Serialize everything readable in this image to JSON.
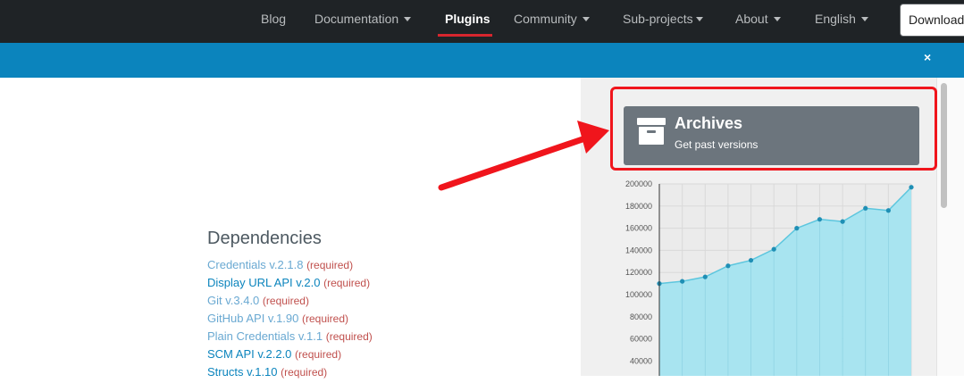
{
  "nav": {
    "items": [
      {
        "label": "Blog",
        "dropdown": false,
        "active": false
      },
      {
        "label": "Documentation",
        "dropdown": true,
        "active": false
      },
      {
        "label": "Plugins",
        "dropdown": false,
        "active": true
      },
      {
        "label": "Community",
        "dropdown": true,
        "active": false
      },
      {
        "label": "Sub-projects",
        "dropdown": true,
        "active": false
      },
      {
        "label": "About",
        "dropdown": true,
        "active": false
      },
      {
        "label": "English",
        "dropdown": true,
        "active": false
      }
    ],
    "download_label": "Download"
  },
  "banner": {
    "close_glyph": "×"
  },
  "archives": {
    "title": "Archives",
    "subtitle": "Get past versions"
  },
  "chart_data": {
    "type": "area",
    "title": "",
    "xlabel": "",
    "ylabel": "",
    "ylim": [
      0,
      200000
    ],
    "yticks": [
      40000,
      60000,
      80000,
      100000,
      120000,
      140000,
      160000,
      180000,
      200000
    ],
    "tick_labels": [
      "40000",
      "60000",
      "80000",
      "100000",
      "120000",
      "140000",
      "160000",
      "180000",
      "200000"
    ],
    "grid": true,
    "legend": "none",
    "values": [
      110000,
      112000,
      116000,
      126000,
      131000,
      141000,
      160000,
      168000,
      166000,
      178000,
      176000,
      197000
    ],
    "color": "#a4e4f0",
    "line_color": "#5cc6de"
  },
  "dependencies": {
    "title": "Dependencies",
    "items": [
      {
        "name": "Credentials v.2.1.8",
        "note": "(required)",
        "visited": true
      },
      {
        "name": "Display URL API v.2.0",
        "note": "(required)",
        "visited": false
      },
      {
        "name": "Git v.3.4.0",
        "note": "(required)",
        "visited": true
      },
      {
        "name": "GitHub API v.1.90",
        "note": "(required)",
        "visited": true
      },
      {
        "name": "Plain Credentials v.1.1",
        "note": "(required)",
        "visited": true
      },
      {
        "name": "SCM API v.2.2.0",
        "note": "(required)",
        "visited": false
      },
      {
        "name": "Structs v.1.10",
        "note": "(required)",
        "visited": false
      }
    ]
  },
  "colors": {
    "navbar_bg": "#1f2326",
    "banner_bg": "#0b84bd",
    "archives_bg": "#6c757d",
    "highlight": "#f0151c",
    "active_tab_underline": "#d7262e"
  }
}
